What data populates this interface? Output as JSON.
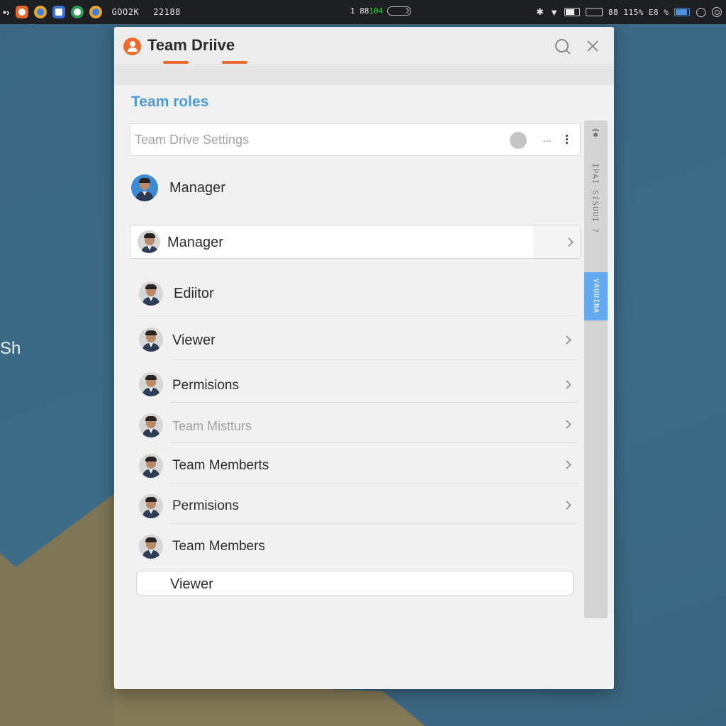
{
  "statusbar": {
    "left_text_1": "GOO2K",
    "left_text_2": "22188",
    "center_text_a": "1 88",
    "center_text_b": "104",
    "right_text": "88 115% E8 %"
  },
  "desktop": {
    "partial_text": "Sh"
  },
  "window": {
    "title": "Team Driive",
    "section_title": "Team roles",
    "settings_placeholder": "Team Drive Settings",
    "settings_ellipsis": "...",
    "header_role": "Manager",
    "card_role": "Manager",
    "roles": [
      {
        "label": "Ediitor"
      },
      {
        "label": "Viewer"
      },
      {
        "label": "Permisions"
      },
      {
        "label": "Team Mistturs"
      },
      {
        "label": "Team Memberts"
      },
      {
        "label": "Permisions"
      },
      {
        "label": "Team Members"
      }
    ],
    "viewer_box_label": "Viewer",
    "sidepanel": {
      "vertical_text": "IPAI SISUUI 7",
      "thumb_text": "VAUUINA"
    }
  },
  "colors": {
    "accent_blue": "#4d9ad8",
    "app_orange": "#ee6a2c",
    "scroll_thumb": "#64aaf0"
  }
}
